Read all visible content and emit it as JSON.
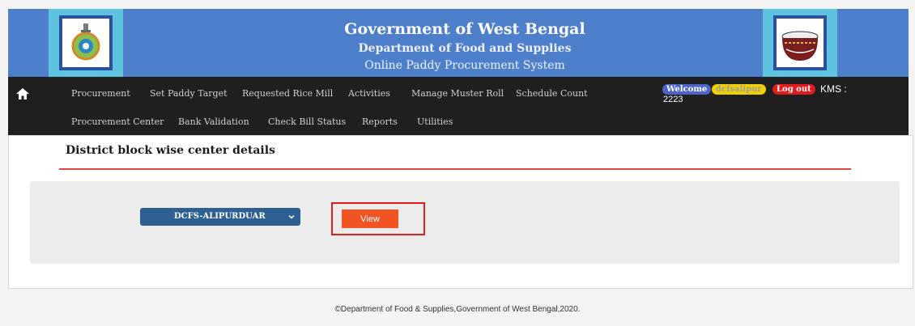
{
  "header": {
    "title": "Government of West Bengal",
    "department": "Department of Food and Supplies",
    "system": "Online Paddy Procurement System"
  },
  "nav": {
    "row1": [
      "Procurement",
      "Set Paddy Target",
      "Requested Rice Mill",
      "Activities",
      "Manage Muster Roll",
      "Schedule Count"
    ],
    "row2": [
      "Procurement Center",
      "Bank Validation",
      "Check Bill Status",
      "Reports",
      "Utilities"
    ],
    "welcome": "Welcome",
    "user": "dcfsalipur",
    "logout": "Log out",
    "kms_label": "KMS :",
    "kms_value": "2223"
  },
  "main": {
    "title": "District block wise center details",
    "select_value": "DCFS-ALIPURDUAR",
    "view_label": "View"
  },
  "footer": {
    "text": "©Department of Food & Supplies,Government of West Bengal,2020."
  },
  "colors": {
    "header_bg": "#4e7fcb",
    "logo_bg": "#5ec3df",
    "nav_bg": "#1f1f1f",
    "accent": "#f25322",
    "select_bg": "#2e5f93"
  }
}
